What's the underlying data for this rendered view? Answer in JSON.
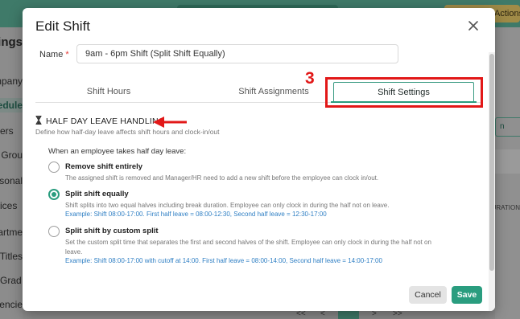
{
  "background": {
    "actions_label": "Actions",
    "sidebar_items": [
      "ttings",
      "ompany",
      "edule",
      "ers",
      "er Grou",
      "rsonal",
      "ices",
      "partme",
      "b Titles",
      "Grad",
      "rrencie"
    ],
    "right_column_header": "URATION",
    "right_button_label": "n",
    "pager": [
      "<<",
      "<",
      "1",
      ">",
      ">>"
    ]
  },
  "modal": {
    "title": "Edit Shift",
    "name_label": "Name",
    "name_required_mark": "*",
    "name_value": "9am - 6pm Shift (Split Shift Equally)",
    "tabs": [
      {
        "label": "Shift Hours"
      },
      {
        "label": "Shift Assignments"
      },
      {
        "label": "Shift Settings",
        "active": true
      }
    ],
    "annotation_step": "3",
    "section": {
      "title": "HALF DAY LEAVE HANDLING",
      "description": "Define how half-day leave affects shift hours and clock-in/out",
      "question": "When an employee takes half day leave:",
      "options": [
        {
          "title": "Remove shift entirely",
          "description": "The assigned shift is removed and Manager/HR need to add a new shift before the employee can clock in/out.",
          "example": "",
          "selected": false
        },
        {
          "title": "Split shift equally",
          "description": "Shift splits into two equal halves including break duration. Employee can only clock in during the half not on leave.",
          "example": "Example: Shift 08:00-17:00. First half leave = 08:00-12:30, Second half leave = 12:30-17:00",
          "selected": true
        },
        {
          "title": "Split shift by custom split",
          "description": "Set the custom split time that separates the first and second halves of the shift. Employee can only clock in during the half not on leave.",
          "example": "Example: Shift 08:00-17:00 with cutoff at 14:00. First half leave = 08:00-14:00, Second half leave = 14:00-17:00",
          "selected": false
        }
      ]
    },
    "buttons": {
      "cancel": "Cancel",
      "save": "Save"
    }
  },
  "colors": {
    "accent": "#2a9d7f",
    "annotation_red": "#e21818",
    "link_blue": "#2f7fc4"
  }
}
